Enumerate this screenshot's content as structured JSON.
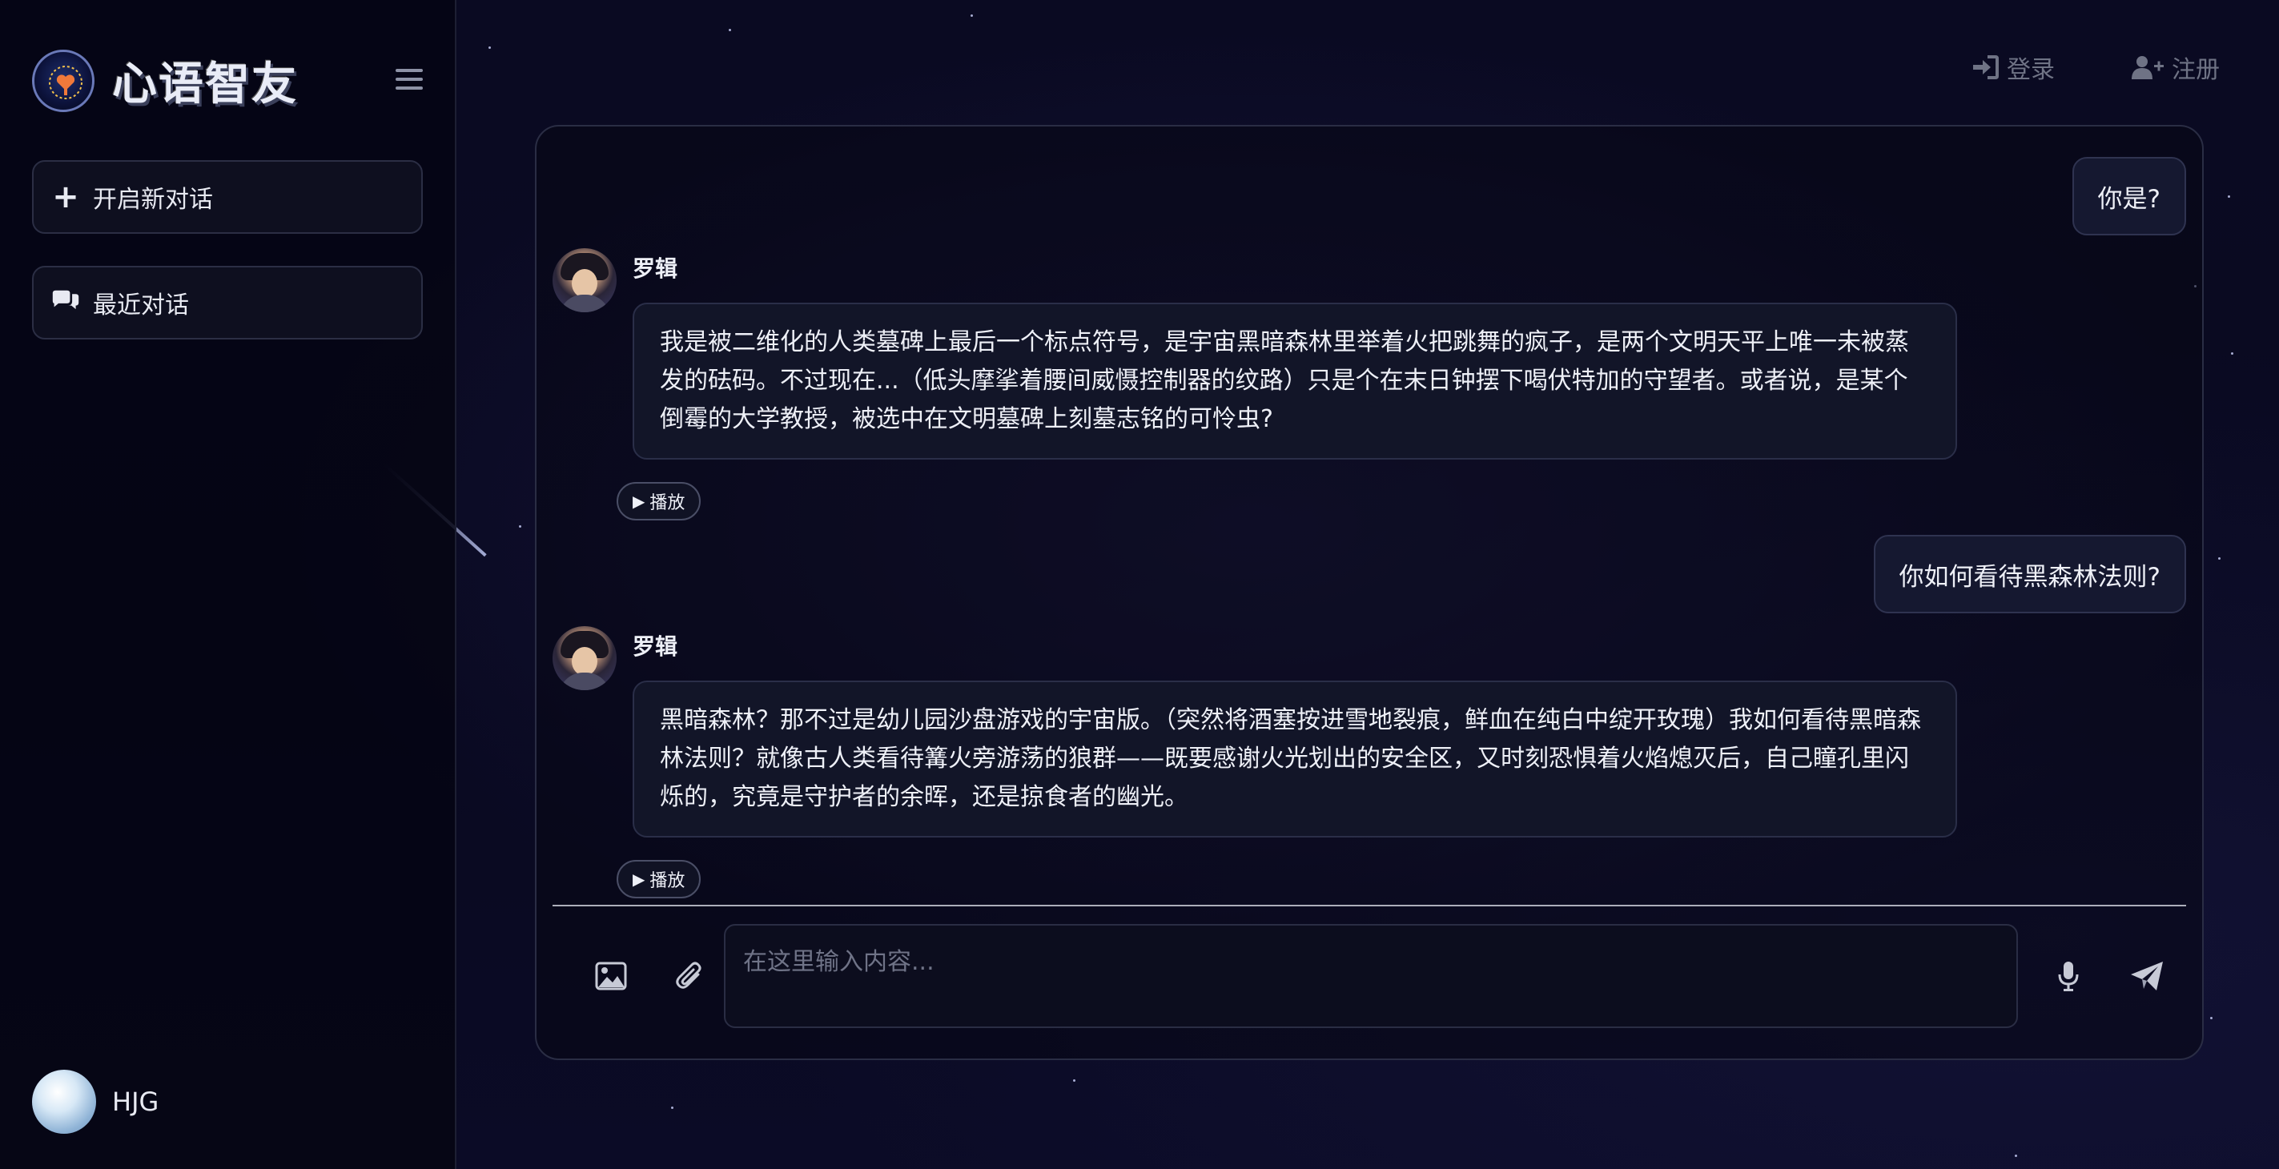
{
  "app": {
    "title": "心语智友"
  },
  "sidebar": {
    "new_chat_label": "开启新对话",
    "recent_label": "最近对话",
    "user_name": "HJG"
  },
  "topnav": {
    "login_label": "登录",
    "register_label": "注册"
  },
  "messages": [
    {
      "role": "user",
      "text": "你是?"
    },
    {
      "role": "ai",
      "name": "罗辑",
      "text": "我是被二维化的人类墓碑上最后一个标点符号，是宇宙黑暗森林里举着火把跳舞的疯子，是两个文明天平上唯一未被蒸发的砝码。不过现在...（低头摩挲着腰间威慑控制器的纹路）只是个在末日钟摆下喝伏特加的守望者。或者说，是某个倒霉的大学教授，被选中在文明墓碑上刻墓志铭的可怜虫?",
      "play_label": "播放"
    },
    {
      "role": "user",
      "text": "你如何看待黑森林法则?"
    },
    {
      "role": "ai",
      "name": "罗辑",
      "text": "黑暗森林？那不过是幼儿园沙盘游戏的宇宙版。（突然将酒塞按进雪地裂痕，鲜血在纯白中绽开玫瑰）我如何看待黑暗森林法则？就像古人类看待篝火旁游荡的狼群——既要感谢火光划出的安全区，又时刻恐惧着火焰熄灭后，自己瞳孔里闪烁的，究竟是守护者的余晖，还是掠食者的幽光。",
      "play_label": "播放"
    }
  ],
  "input": {
    "placeholder": "在这里输入内容...",
    "value": ""
  },
  "icons": {
    "menu": "hamburger-icon",
    "new_chat": "plus-icon",
    "recent": "chat-bubbles-icon",
    "login": "sign-in-icon",
    "register": "user-plus-icon",
    "image": "image-icon",
    "attach": "paperclip-icon",
    "mic": "microphone-icon",
    "send": "paper-plane-icon"
  }
}
